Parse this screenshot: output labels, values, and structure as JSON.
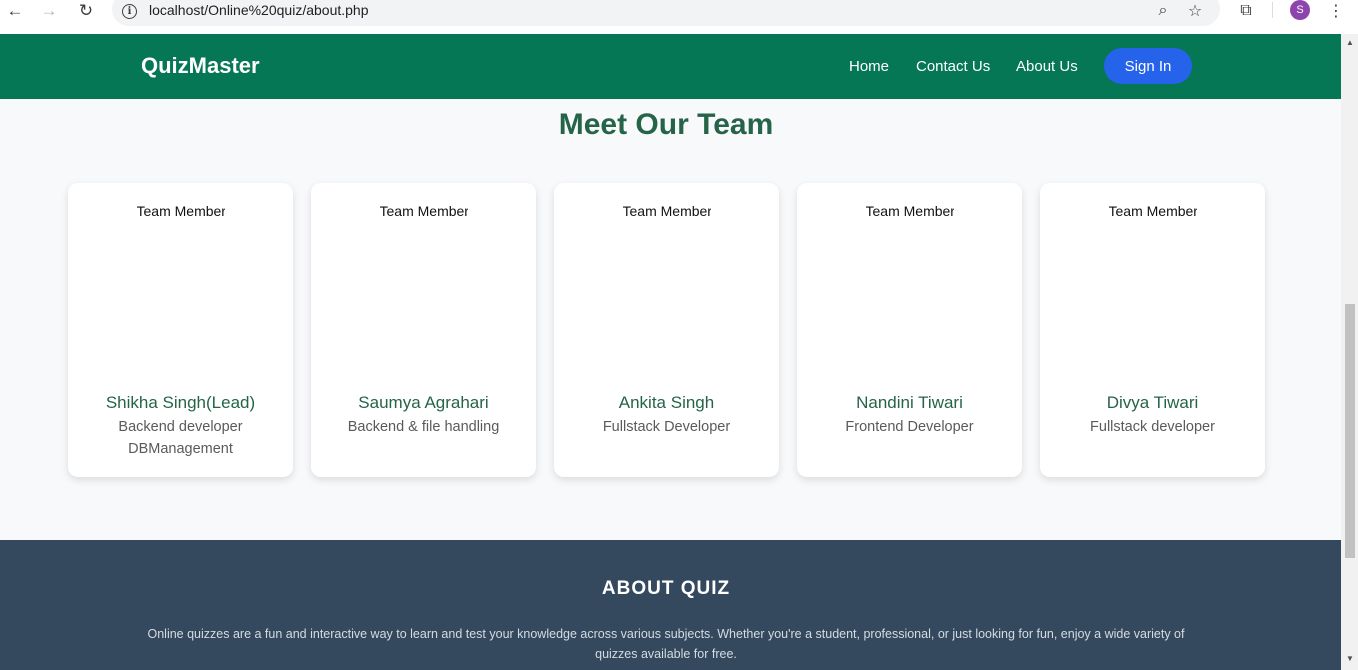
{
  "browser": {
    "back_icon": "←",
    "forward_icon": "→",
    "reload_icon": "↻",
    "info_icon": "i",
    "url": "localhost/Online%20quiz/about.php",
    "zoom_icon": "⌕",
    "star_icon": "☆",
    "extensions_icon": "⧉",
    "profile_initial": "S",
    "menu_icon": "⋮"
  },
  "nav": {
    "brand": "QuizMaster",
    "links": [
      "Home",
      "Contact Us",
      "About Us"
    ],
    "signin": "Sign In"
  },
  "team": {
    "title": "Meet Our Team",
    "image_alt": "Team Member",
    "members": [
      {
        "name": "Shikha Singh(Lead)",
        "role": "Backend developer DBManagement"
      },
      {
        "name": "Saumya Agrahari",
        "role": "Backend & file handling"
      },
      {
        "name": "Ankita Singh",
        "role": "Fullstack Developer"
      },
      {
        "name": "Nandini Tiwari",
        "role": "Frontend Developer"
      },
      {
        "name": "Divya Tiwari",
        "role": "Fullstack developer"
      }
    ]
  },
  "about": {
    "title": "ABOUT QUIZ",
    "text": "Online quizzes are a fun and interactive way to learn and test your knowledge across various subjects. Whether you're a student, professional, or just looking for fun, enjoy a wide variety of quizzes available for free."
  },
  "colors": {
    "nav_bg": "#067754",
    "accent_green": "#256448",
    "signin_bg": "#2563eb",
    "about_bg": "#34495e"
  }
}
